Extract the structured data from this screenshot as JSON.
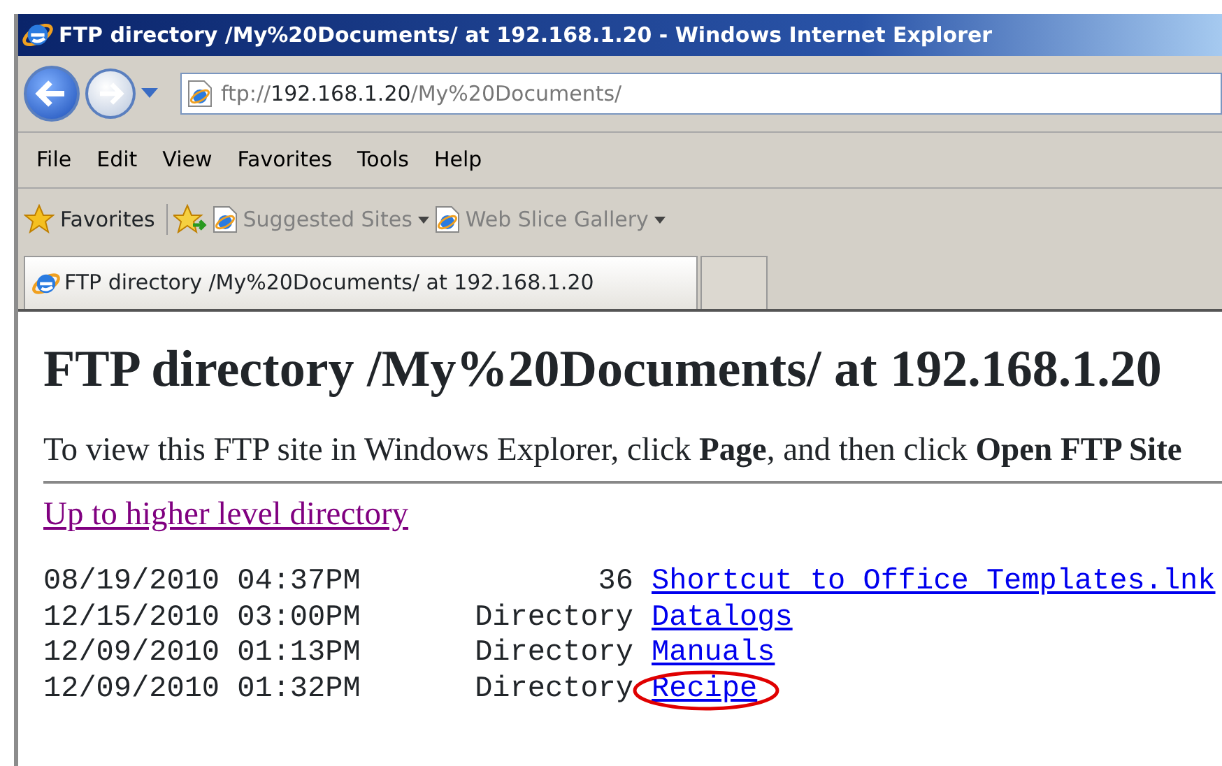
{
  "window": {
    "title": "FTP directory /My%20Documents/ at 192.168.1.20 - Windows Internet Explorer"
  },
  "address": {
    "scheme": "ftp://",
    "host": "192.168.1.20",
    "path": "/My%20Documents/"
  },
  "menu": [
    "File",
    "Edit",
    "View",
    "Favorites",
    "Tools",
    "Help"
  ],
  "favorites_bar": {
    "label": "Favorites",
    "items": [
      {
        "label": "Suggested Sites"
      },
      {
        "label": "Web Slice Gallery"
      }
    ]
  },
  "tabs": [
    {
      "label": "FTP directory /My%20Documents/ at 192.168.1.20",
      "selected": true
    }
  ],
  "page": {
    "heading": "FTP directory /My%20Documents/ at 192.168.1.20",
    "instruction": "To view this FTP site in Windows Explorer, click **Page**, and then click **Open FTP Site**",
    "up_link": "Up to higher level directory",
    "entries": [
      {
        "date": "08/19/2010 04:37PM",
        "size": "36",
        "name": "Shortcut to Office Templates.lnk",
        "circled": false
      },
      {
        "date": "12/15/2010 03:00PM",
        "size": "Directory",
        "name": "Datalogs",
        "circled": false
      },
      {
        "date": "12/09/2010 01:13PM",
        "size": "Directory",
        "name": "Manuals",
        "circled": false
      },
      {
        "date": "12/09/2010 01:32PM",
        "size": "Directory",
        "name": "Recipe",
        "circled": true
      }
    ]
  }
}
